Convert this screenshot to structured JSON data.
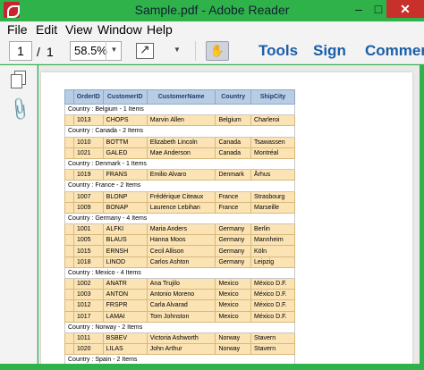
{
  "window": {
    "title": "Sample.pdf - Adobe Reader",
    "minimize": "–",
    "maximize": "□",
    "close": "✕"
  },
  "menu": {
    "file": "File",
    "edit": "Edit",
    "view": "View",
    "window": "Window",
    "help": "Help"
  },
  "toolbar": {
    "page_current": "1",
    "page_separator": "/",
    "page_total": "1",
    "zoom": "58.5%",
    "tools": "Tools",
    "sign": "Sign",
    "comment": "Commen"
  },
  "icons": {
    "app": "adobe-reader-icon",
    "pages": "pages-icon",
    "attachments": "paperclip-icon",
    "hand": "hand-tool-icon",
    "fit": "fit-page-icon"
  },
  "table": {
    "headers": [
      "OrderID",
      "CustomerID",
      "CustomerName",
      "Country",
      "ShipCity"
    ],
    "groups": [
      {
        "label": "Country : Belgium - 1 Items",
        "rows": [
          [
            "1013",
            "CHOPS",
            "Marvin Allen",
            "Belgium",
            "Charleroi"
          ]
        ]
      },
      {
        "label": "Country : Canada - 2 Items",
        "rows": [
          [
            "1010",
            "BOTTM",
            "Elizabeth Lincoln",
            "Canada",
            "Tsawassen"
          ],
          [
            "1021",
            "GALED",
            "Mae Anderson",
            "Canada",
            "Montréal"
          ]
        ]
      },
      {
        "label": "Country : Denmark - 1 Items",
        "rows": [
          [
            "1019",
            "FRANS",
            "Emilio Alvaro",
            "Denmark",
            "Århus"
          ]
        ]
      },
      {
        "label": "Country : France - 2 Items",
        "rows": [
          [
            "1007",
            "BLONP",
            "Frédérique Citeaux",
            "France",
            "Strasbourg"
          ],
          [
            "1009",
            "BONAP",
            "Laurence Lebihan",
            "France",
            "Marseille"
          ]
        ]
      },
      {
        "label": "Country : Germany - 4 Items",
        "rows": [
          [
            "1001",
            "ALFKI",
            "Maria Anders",
            "Germany",
            "Berlin"
          ],
          [
            "1005",
            "BLAUS",
            "Hanna Moos",
            "Germany",
            "Mannheim"
          ],
          [
            "1015",
            "ERNSH",
            "Cecil Allison",
            "Germany",
            "Köln"
          ],
          [
            "1018",
            "LINOD",
            "Carlos Ashton",
            "Germany",
            "Leipzig"
          ]
        ]
      },
      {
        "label": "Country : Mexico - 4 Items",
        "rows": [
          [
            "1002",
            "ANATR",
            "Ana Trujilo",
            "Mexico",
            "México D.F."
          ],
          [
            "1003",
            "ANTON",
            "Antonio Moreno",
            "Mexico",
            "México D.F."
          ],
          [
            "1012",
            "FRSPR",
            "Carla Alvarad",
            "Mexico",
            "México D.F."
          ],
          [
            "1017",
            "LAMAI",
            "Tom Johnston",
            "Mexico",
            "México D.F."
          ]
        ]
      },
      {
        "label": "Country : Norway - 2 Items",
        "rows": [
          [
            "1011",
            "BSBEV",
            "Victoria Ashworth",
            "Norway",
            "Stavern"
          ],
          [
            "1020",
            "LILAS",
            "John Arthur",
            "Norway",
            "Stavern"
          ]
        ]
      },
      {
        "label": "Country : Spain - 2 Items",
        "rows": []
      }
    ]
  }
}
